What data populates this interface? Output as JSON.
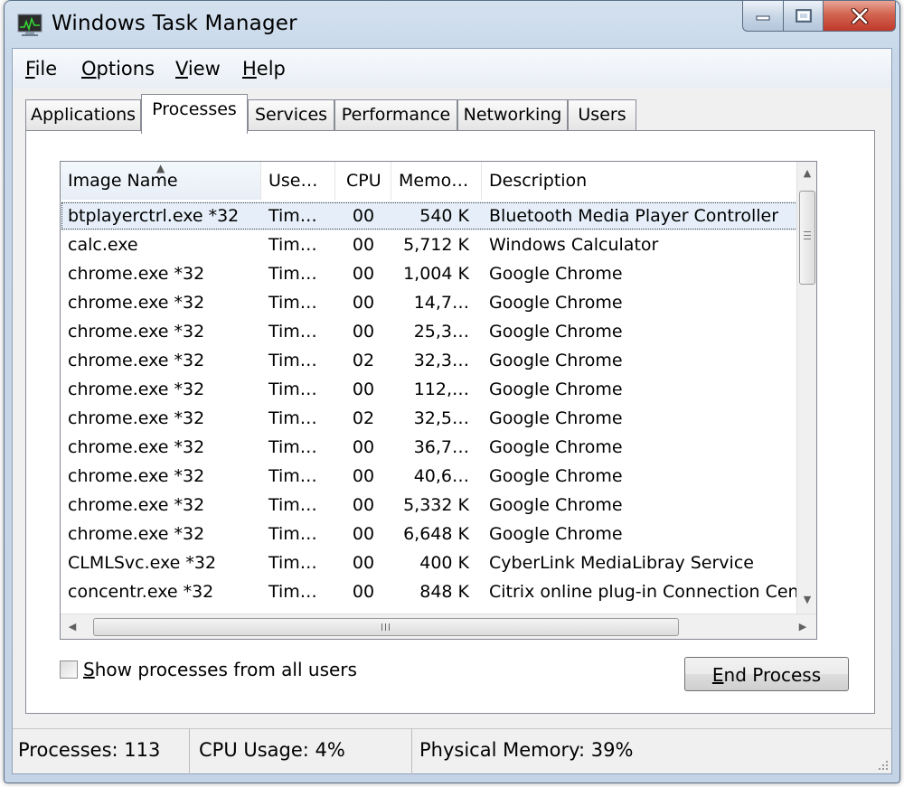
{
  "window": {
    "title": "Windows Task Manager"
  },
  "icons": {
    "app": "task-manager-icon",
    "minimize": "minimize-icon",
    "maximize": "maximize-icon",
    "close": "close-icon"
  },
  "menu": [
    {
      "pre": "",
      "key": "F",
      "post": "ile"
    },
    {
      "pre": "",
      "key": "O",
      "post": "ptions"
    },
    {
      "pre": "",
      "key": "V",
      "post": "iew"
    },
    {
      "pre": "",
      "key": "H",
      "post": "elp"
    }
  ],
  "tabs": [
    "Applications",
    "Processes",
    "Services",
    "Performance",
    "Networking",
    "Users"
  ],
  "active_tab": "Processes",
  "columns": [
    "Image Name",
    "Use…",
    "CPU",
    "Memo…",
    "Description"
  ],
  "rows": [
    [
      "btplayerctrl.exe *32",
      "Tim…",
      "00",
      "540 K",
      "Bluetooth Media Player Controller"
    ],
    [
      "calc.exe",
      "Tim…",
      "00",
      "5,712 K",
      "Windows Calculator"
    ],
    [
      "chrome.exe *32",
      "Tim…",
      "00",
      "1,004 K",
      "Google Chrome"
    ],
    [
      "chrome.exe *32",
      "Tim…",
      "00",
      "14,7…",
      "Google Chrome"
    ],
    [
      "chrome.exe *32",
      "Tim…",
      "00",
      "25,3…",
      "Google Chrome"
    ],
    [
      "chrome.exe *32",
      "Tim…",
      "02",
      "32,3…",
      "Google Chrome"
    ],
    [
      "chrome.exe *32",
      "Tim…",
      "00",
      "112,…",
      "Google Chrome"
    ],
    [
      "chrome.exe *32",
      "Tim…",
      "02",
      "32,5…",
      "Google Chrome"
    ],
    [
      "chrome.exe *32",
      "Tim…",
      "00",
      "36,7…",
      "Google Chrome"
    ],
    [
      "chrome.exe *32",
      "Tim…",
      "00",
      "40,6…",
      "Google Chrome"
    ],
    [
      "chrome.exe *32",
      "Tim…",
      "00",
      "5,332 K",
      "Google Chrome"
    ],
    [
      "chrome.exe *32",
      "Tim…",
      "00",
      "6,648 K",
      "Google Chrome"
    ],
    [
      "CLMLSvc.exe *32",
      "Tim…",
      "00",
      "400 K",
      "CyberLink MediaLibray Service"
    ],
    [
      "concentr.exe *32",
      "Tim…",
      "00",
      "848 K",
      "Citrix online plug-in Connection Center"
    ]
  ],
  "selected_row": 0,
  "show_all": {
    "pre": "",
    "key": "S",
    "post": "how processes from all users",
    "checked": false
  },
  "end_process": {
    "pre": "",
    "key": "E",
    "post": "nd Process"
  },
  "status": {
    "processes": "Processes: 113",
    "cpu": "CPU Usage: 4%",
    "memory": "Physical Memory: 39%"
  },
  "colors": {
    "close_red": "#c0392b",
    "selection": "#e6eff9",
    "frame": "#c8d8ea"
  }
}
